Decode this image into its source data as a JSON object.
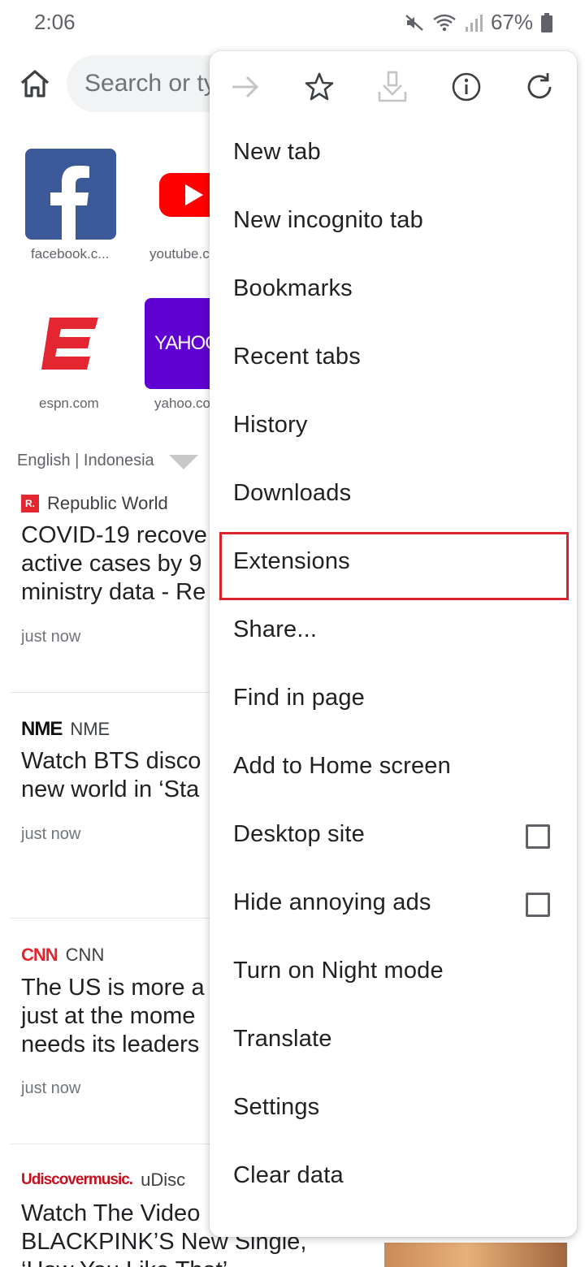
{
  "status": {
    "time": "2:06",
    "battery": "67%"
  },
  "toolbar": {
    "search_placeholder": "Search or ty"
  },
  "speed_dial": [
    {
      "label": "facebook.c...",
      "icon": "facebook-logo"
    },
    {
      "label": "youtube.c",
      "icon": "youtube-logo"
    },
    {
      "label": "espn.com",
      "icon": "espn-logo"
    },
    {
      "label": "yahoo.co",
      "icon": "yahoo-logo",
      "logo_text": "YAHOO"
    }
  ],
  "language": {
    "label": "English | Indonesia"
  },
  "news": [
    {
      "source": "Republic World",
      "logo_text": "R.",
      "title": "COVID-19 recove\nactive cases by 9\nministry data - Re",
      "time": "just now"
    },
    {
      "source": "NME",
      "logo_text": "NME",
      "title": "Watch BTS disco\nnew world in ‘Sta",
      "time": "just now"
    },
    {
      "source": "CNN",
      "logo_text": "CNN",
      "title": "The US is more a\njust at the mome\nneeds its leaders",
      "time": "just now"
    },
    {
      "source": "uDisc",
      "logo_text": "Udiscovermusic.",
      "title": "Watch The Video\nBLACKPINK’S New Single,\n‘How You Like That’"
    }
  ],
  "menu": {
    "icons": [
      "forward-icon",
      "bookmark-star-icon",
      "download-icon",
      "info-icon",
      "reload-icon"
    ],
    "items": [
      {
        "label": "New tab"
      },
      {
        "label": "New incognito tab"
      },
      {
        "label": "Bookmarks"
      },
      {
        "label": "Recent tabs"
      },
      {
        "label": "History"
      },
      {
        "label": "Downloads"
      },
      {
        "label": "Extensions",
        "highlighted": true
      },
      {
        "label": "Share..."
      },
      {
        "label": "Find in page"
      },
      {
        "label": "Add to Home screen"
      },
      {
        "label": "Desktop site",
        "checkbox": false
      },
      {
        "label": "Hide annoying ads",
        "checkbox": false
      },
      {
        "label": "Turn on Night mode"
      },
      {
        "label": "Translate"
      },
      {
        "label": "Settings"
      },
      {
        "label": "Clear data"
      }
    ]
  },
  "colors": {
    "highlight": "#d9232e",
    "facebook": "#3b5998",
    "youtube": "#ff0000",
    "espn": "#e3262f",
    "yahoo": "#5f01d1"
  }
}
